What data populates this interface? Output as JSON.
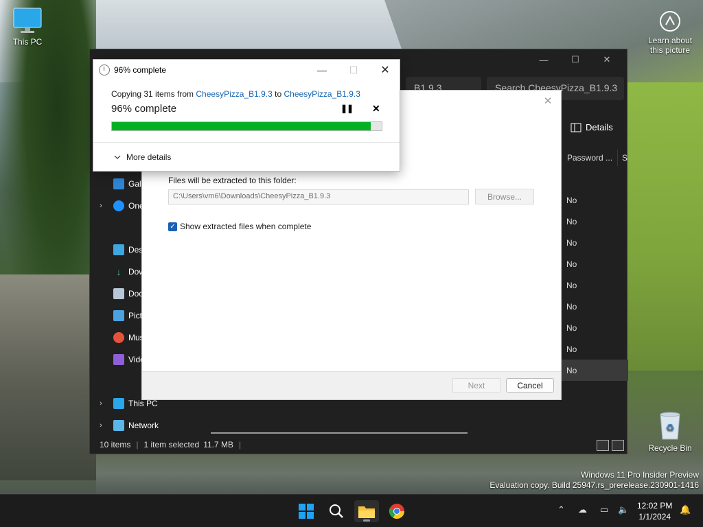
{
  "desktop": {
    "this_pc_label": "This PC",
    "learn_label_1": "Learn about",
    "learn_label_2": "this picture",
    "recycle_label": "Recycle Bin",
    "watermark_line1": "Windows 11 Pro Insider Preview",
    "watermark_line2": "Evaluation copy. Build 25947.rs_prerelease.230901-1416"
  },
  "explorer": {
    "tab_1": "B1.9.3",
    "tab_2": "Search CheesyPizza_B1.9.3",
    "details_label": "Details",
    "column_password": "Password ...",
    "column_size": "Si",
    "nav": {
      "gallery": "Gall",
      "onedrive": "One",
      "desktop": "Desk",
      "downloads": "Dow",
      "documents": "Doc",
      "pictures": "Pict",
      "music": "Mus",
      "videos": "Vide",
      "this_pc": "This PC",
      "network": "Network"
    },
    "rows": [
      "No",
      "No",
      "No",
      "No",
      "No",
      "No",
      "No",
      "No",
      "No"
    ],
    "status_items": "10 items",
    "status_selected": "1 item selected",
    "status_size": "11.7 MB"
  },
  "wizard": {
    "folder_label": "Files will be extracted to this folder:",
    "path_value": "C:\\Users\\vm6\\Downloads\\CheesyPizza_B1.9.3",
    "browse_label": "Browse...",
    "show_files_label": "Show extracted files when complete",
    "next_label": "Next",
    "cancel_label": "Cancel"
  },
  "copy_dialog": {
    "title": "96% complete",
    "copy_prefix": "Copying 31 items from ",
    "source": "CheesyPizza_B1.9.3",
    "to_word": " to ",
    "destination": "CheesyPizza_B1.9.3",
    "percent_text": "96% complete",
    "progress": 0.96,
    "progress_color": "#06b025",
    "more_details": "More details"
  },
  "taskbar": {
    "time": "12:02 PM",
    "date": "1/1/2024"
  }
}
